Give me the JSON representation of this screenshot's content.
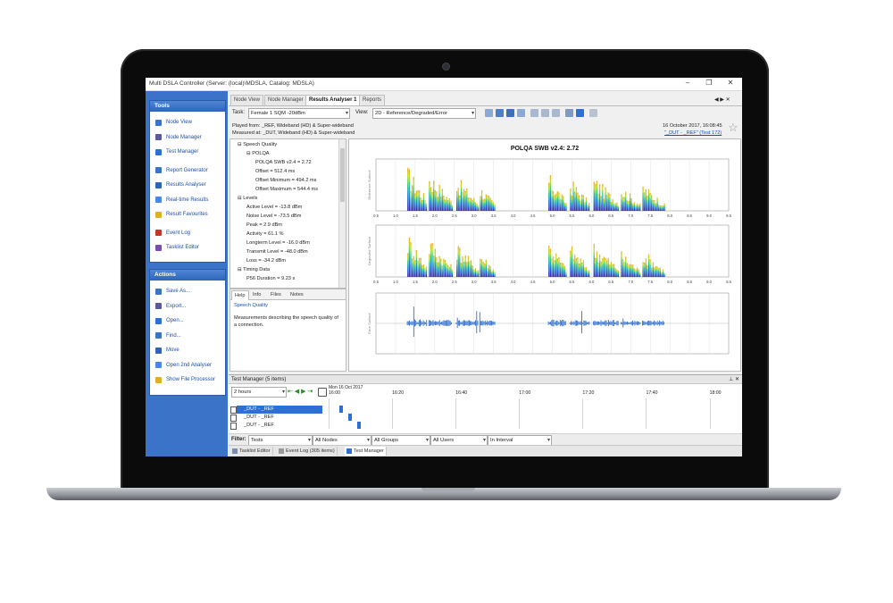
{
  "window": {
    "title": "Multi DSLA Controller (Server: (local)\\MDSLA, Catalog: MDSLA)"
  },
  "sidebar": {
    "tools_title": "Tools",
    "tools": [
      {
        "label": "Node View",
        "icon": "node-view-icon"
      },
      {
        "label": "Node Manager",
        "icon": "node-manager-icon"
      },
      {
        "label": "Test Manager",
        "icon": "test-manager-icon"
      },
      {
        "label": "Report Generator",
        "icon": "report-generator-icon"
      },
      {
        "label": "Results Analyser",
        "icon": "results-analyser-icon"
      },
      {
        "label": "Real-time Results",
        "icon": "realtime-results-icon"
      },
      {
        "label": "Result Favourites",
        "icon": "star-icon"
      },
      {
        "label": "Event Log",
        "icon": "event-log-icon"
      },
      {
        "label": "Tasklist Editor",
        "icon": "tasklist-editor-icon"
      }
    ],
    "actions_title": "Actions",
    "actions": [
      {
        "label": "Save As...",
        "icon": "save-icon"
      },
      {
        "label": "Export...",
        "icon": "export-icon"
      },
      {
        "label": "Open...",
        "icon": "open-folder-icon"
      },
      {
        "label": "Find...",
        "icon": "find-icon"
      },
      {
        "label": "Move",
        "icon": "move-icon"
      },
      {
        "label": "Open 2nd Analyser",
        "icon": "analyser-icon"
      },
      {
        "label": "Show File Processor",
        "icon": "file-processor-icon"
      }
    ]
  },
  "tabs": [
    "Node View",
    "Node Manager",
    "Results Analyser 1",
    "Reports"
  ],
  "toolbar": {
    "task_label": "Task:",
    "task_value": "Female 1 SQM -20dBm",
    "view_label": "View:",
    "view_value": "2D - Reference/Degraded/Error"
  },
  "info": {
    "played_from": "Played from: _REF, Wideband (HD) & Super-wideband",
    "measured_at": "Measured at: _DUT, Wideband (HD) & Super-wideband",
    "date": "16 October 2017, 16:08:45",
    "link": "\"_DUT - _REF\" (Test 172)"
  },
  "tree": [
    {
      "text": "Speech Quality",
      "level": 0,
      "mark": "⊟"
    },
    {
      "text": "POLQA",
      "level": 1,
      "mark": "⊟"
    },
    {
      "text": "POLQA SWB v2.4 = 2.72",
      "level": 2
    },
    {
      "text": "Offset = 512.4 ms",
      "level": 2
    },
    {
      "text": "Offset Minimum = 494.2 ms",
      "level": 2
    },
    {
      "text": "Offset Maximum = 544.4 ms",
      "level": 2
    },
    {
      "text": "Levels",
      "level": 0,
      "mark": "⊟"
    },
    {
      "text": "Active Level = -13.8 dBm",
      "level": 1
    },
    {
      "text": "Noise Level = -73.5 dBm",
      "level": 1
    },
    {
      "text": "Peak = 2.9 dBm",
      "level": 1
    },
    {
      "text": "Activity = 61.1 %",
      "level": 1
    },
    {
      "text": "Longterm Level = -16.0 dBm",
      "level": 1
    },
    {
      "text": "Transmit Level = -48.0 dBm",
      "level": 1
    },
    {
      "text": "Loss = -34.2 dBm",
      "level": 1
    },
    {
      "text": "Timing Data",
      "level": 0,
      "mark": "⊟"
    },
    {
      "text": "P56 Duration = 9.23 s",
      "level": 1
    }
  ],
  "help": {
    "tabs": [
      "Help",
      "Info",
      "Files",
      "Notes"
    ],
    "title": "Speech Quality",
    "text_line1": "Measurements describing the speech quality of",
    "text_line2": "a connection."
  },
  "chart_data": {
    "type": "bar",
    "title": "POLQA SWB v2.4: 2.72",
    "panels": [
      "Reference Surface",
      "Degraded Surface",
      "Error Surface"
    ],
    "x_ticks": [
      "0.5",
      "1.0",
      "1.5",
      "2.0",
      "2.5",
      "3.0",
      "3.5",
      "4.0",
      "4.5",
      "5.0",
      "5.5",
      "6.0",
      "6.5",
      "7.0",
      "7.5",
      "8.0",
      "8.5",
      "9.0",
      "9.5"
    ],
    "xlim": [
      0.5,
      9.5
    ],
    "bursts": [
      {
        "start": 1.3,
        "end": 1.8,
        "peak": 0.95
      },
      {
        "start": 1.85,
        "end": 2.45,
        "peak": 0.85
      },
      {
        "start": 2.55,
        "end": 3.1,
        "peak": 0.75
      },
      {
        "start": 3.15,
        "end": 3.55,
        "peak": 0.55
      },
      {
        "start": 4.9,
        "end": 5.35,
        "peak": 0.8
      },
      {
        "start": 5.45,
        "end": 5.95,
        "peak": 0.7
      },
      {
        "start": 6.05,
        "end": 6.7,
        "peak": 0.75
      },
      {
        "start": 6.75,
        "end": 7.25,
        "peak": 0.55
      },
      {
        "start": 7.3,
        "end": 7.85,
        "peak": 0.6
      }
    ]
  },
  "test_manager": {
    "title": "Test Manager (5 items)",
    "range": "2 hours",
    "date_label": "Mon 16 Oct 2017",
    "times": [
      "16:00",
      "16:20",
      "16:40",
      "17:00",
      "17:20",
      "17:40",
      "18:00"
    ],
    "rows": [
      "_DUT - _REF",
      "_DUT - _REF",
      "_DUT - _REF"
    ],
    "filter_label": "Filter:",
    "filters": [
      "Tests",
      "All Nodes",
      "All Groups",
      "All Users",
      "In Interval"
    ]
  },
  "bottom_tabs": [
    "Tasklist Editor",
    "Event Log (305 items)",
    "Test Manager"
  ],
  "colors": {
    "sidebar": "#3b73c8",
    "selection": "#2c6fd6",
    "link": "#1c4fa8"
  }
}
